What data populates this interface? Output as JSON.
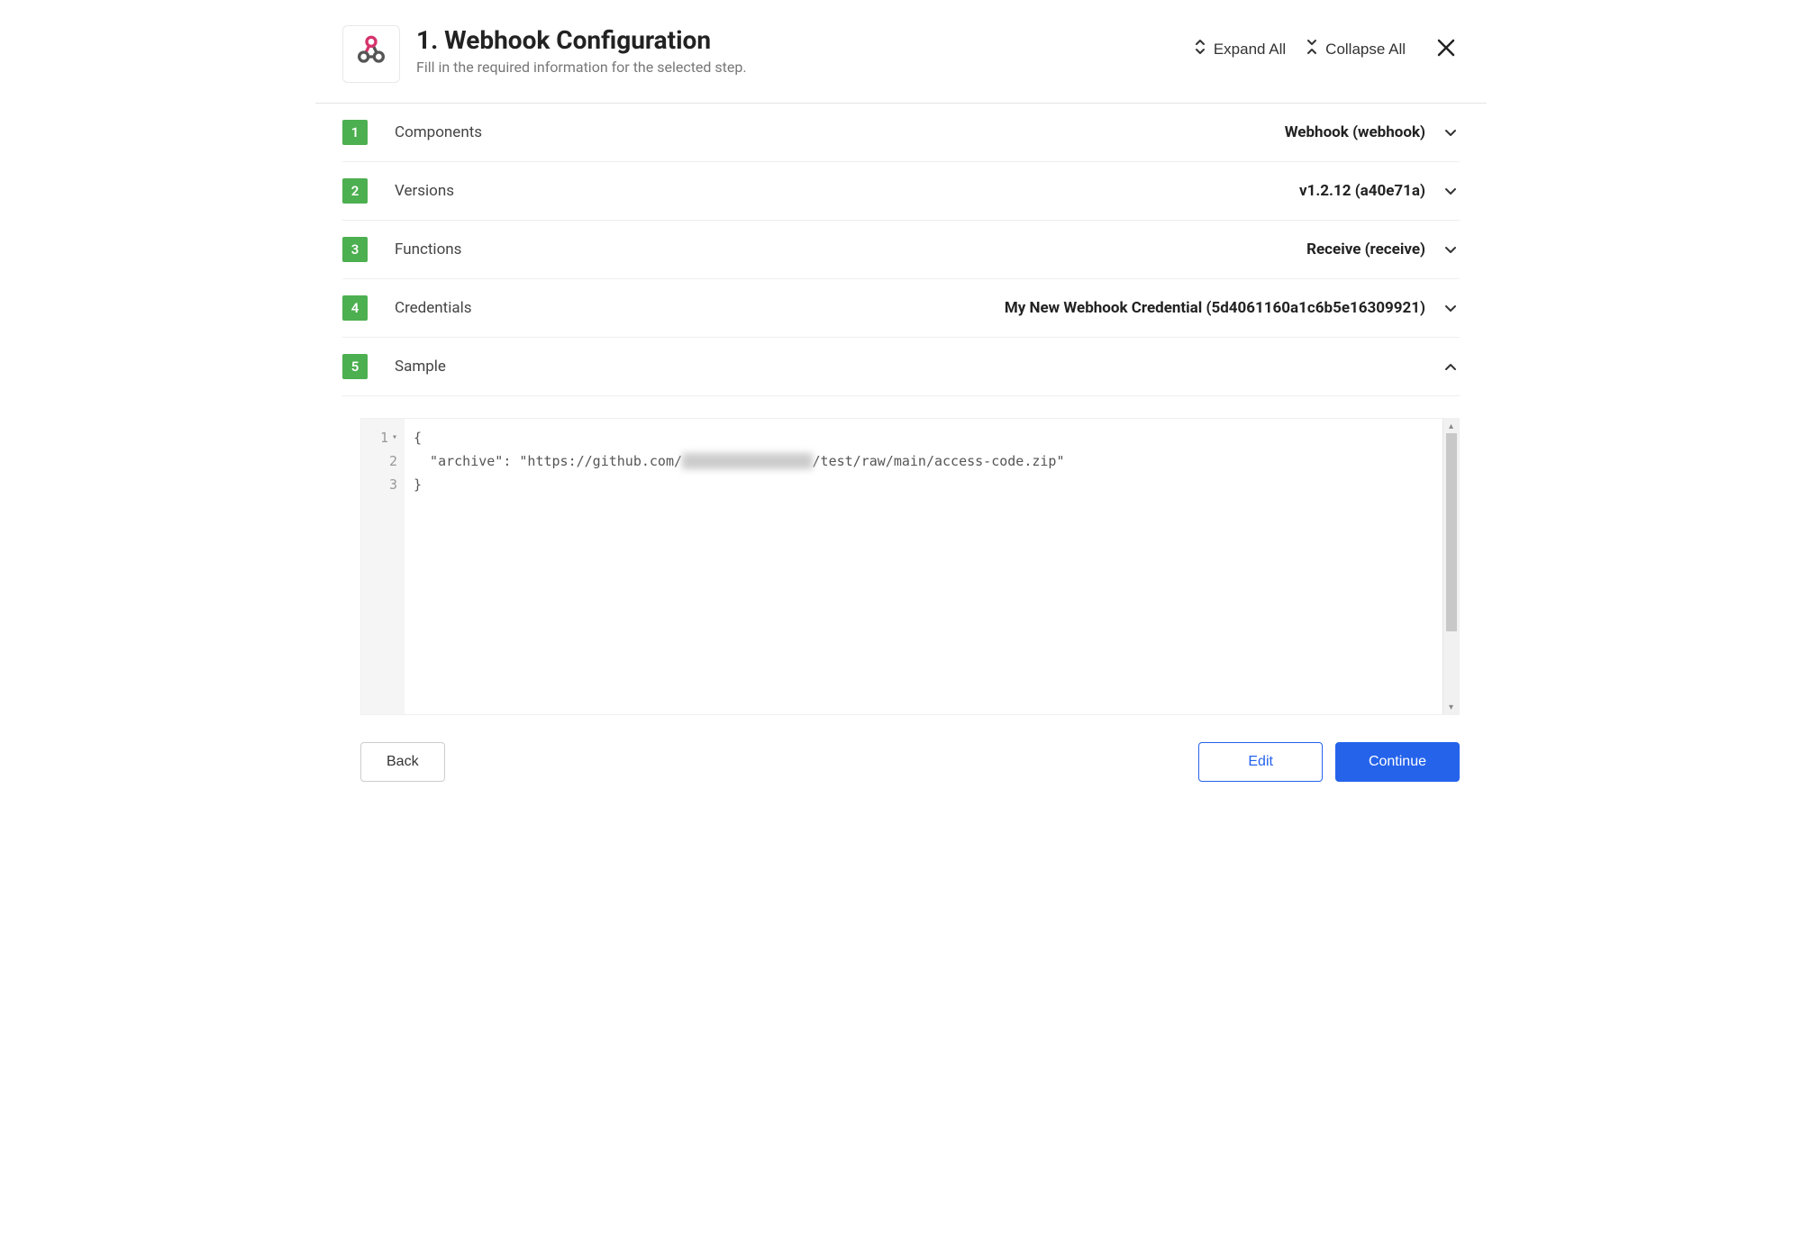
{
  "header": {
    "title": "1. Webhook Configuration",
    "subtitle": "Fill in the required information for the selected step.",
    "expand_label": "Expand All",
    "collapse_label": "Collapse All"
  },
  "steps": [
    {
      "num": "1",
      "label": "Components",
      "value": "Webhook (webhook)",
      "expanded": false
    },
    {
      "num": "2",
      "label": "Versions",
      "value": "v1.2.12 (a40e71a)",
      "expanded": false
    },
    {
      "num": "3",
      "label": "Functions",
      "value": "Receive (receive)",
      "expanded": false
    },
    {
      "num": "4",
      "label": "Credentials",
      "value": "My New Webhook Credential (5d4061160a1c6b5e16309921)",
      "expanded": false
    },
    {
      "num": "5",
      "label": "Sample",
      "value": "",
      "expanded": true
    }
  ],
  "code": {
    "line1": "{",
    "line2_prefix": "  \"archive\": \"https://github.com/",
    "line2_redacted": "xxxxxxxxxxxxxxxx",
    "line2_suffix": "/test/raw/main/access-code.zip\"",
    "line3": "}",
    "gutter": [
      "1",
      "2",
      "3"
    ]
  },
  "footer": {
    "back": "Back",
    "edit": "Edit",
    "continue": "Continue"
  }
}
